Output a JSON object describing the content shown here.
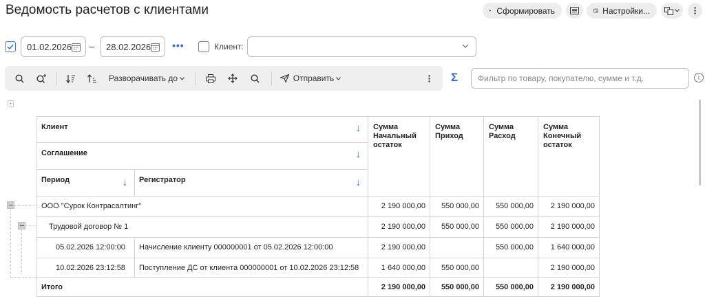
{
  "window": {
    "title": "Ведомость расчетов с клиентами"
  },
  "top_actions": {
    "form_label": "Сформировать",
    "settings_label": "Настройки..."
  },
  "period": {
    "checked": true,
    "date_from": "01.02.2026",
    "separator": "–",
    "date_to": "28.02.2026",
    "more": "•••"
  },
  "client": {
    "checked": false,
    "label": "Клиент:",
    "value": ""
  },
  "toolbar": {
    "expand_label": "Разворачивать до",
    "send_label": "Отправить"
  },
  "sum_icon": "Σ",
  "filter": {
    "placeholder": "Фильтр по товару, покупателю, сумме и т.д.",
    "value": ""
  },
  "table": {
    "headers": {
      "client": "Клиент",
      "agreement": "Соглашение",
      "period": "Период",
      "registrator": "Регистратор",
      "sum_open": "Сумма Начальный остаток",
      "sum_in": "Сумма Приход",
      "sum_out": "Сумма Расход",
      "sum_close": "Сумма Конечный остаток"
    },
    "rows": [
      {
        "label": "ООО \"Сурок Контрасалтинг\"",
        "open": "2 190 000,00",
        "in": "550 000,00",
        "out": "550 000,00",
        "close": "2 190 000,00"
      },
      {
        "label": "Трудовой договор № 1",
        "open": "2 190 000,00",
        "in": "550 000,00",
        "out": "550 000,00",
        "close": "2 190 000,00"
      },
      {
        "period": "05.02.2026 12:00:00",
        "reg": "Начисление клиенту 000000001 от 05.02.2026 12:00:00",
        "open": "2 190 000,00",
        "in": "",
        "out": "550 000,00",
        "close": "1 640 000,00"
      },
      {
        "period": "10.02.2026 23:12:58",
        "reg": "Поступление ДС от клиента 000000001 от 10.02.2026 23:12:58",
        "open": "1 640 000,00",
        "in": "550 000,00",
        "out": "",
        "close": "2 190 000,00"
      }
    ],
    "total": {
      "label": "Итого",
      "open": "2 190 000,00",
      "in": "550 000,00",
      "out": "550 000,00",
      "close": "2 190 000,00"
    }
  },
  "colors": {
    "accent": "#2d6fd6",
    "border": "#d4d4d4"
  }
}
